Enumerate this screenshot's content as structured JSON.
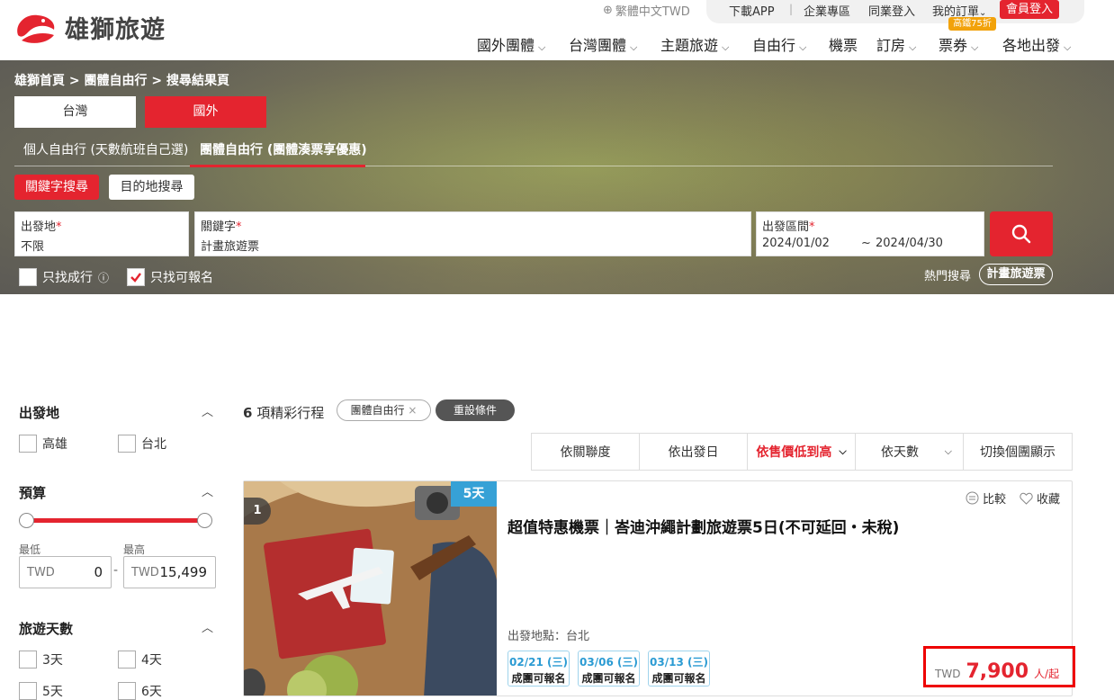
{
  "header": {
    "logo_text": "雄獅旅遊",
    "lang": "繁體中文TWD",
    "util": [
      "下載APP",
      "企業專區",
      "同業登入",
      "我的訂單"
    ],
    "login": "會員登入",
    "promo": "高鐵75折",
    "nav": [
      "國外團體",
      "台灣團體",
      "主題旅遊",
      "自由行",
      "機票",
      "訂房",
      "票券",
      "各地出發"
    ]
  },
  "search": {
    "breadcrumb": "雄獅首頁 > 團體自由行 > 搜尋結果頁",
    "region_tw": "台灣",
    "region_intl": "國外",
    "mode_personal": "個人自由行 (天數航班自己選)",
    "mode_group": "團體自由行 (團體湊票享優惠)",
    "keyword_search": "關鍵字搜尋",
    "dest_search": "目的地搜尋",
    "origin_label": "出發地",
    "origin_value": "不限",
    "keyword_label": "關鍵字",
    "keyword_value": "計畫旅遊票",
    "date_label": "出發區間",
    "date_start": "2024/01/02",
    "date_sep": "~",
    "date_end": "2024/04/30",
    "only_confirmed": "只找成行",
    "only_available": "只找可報名",
    "hot_label": "熱門搜尋",
    "hot_tag": "計畫旅遊票"
  },
  "sidebar": {
    "origin_title": "出發地",
    "origin_options": [
      "高雄",
      "台北"
    ],
    "budget_title": "預算",
    "min_label": "最低",
    "max_label": "最高",
    "currency": "TWD",
    "min_value": "0",
    "max_value": "15,499",
    "days_title": "旅遊天數",
    "day_options": [
      "3天",
      "4天",
      "5天",
      "6天"
    ]
  },
  "results": {
    "count": "6",
    "count_suffix": "項精彩行程",
    "filter_chip": "團體自由行",
    "reset": "重設條件",
    "sorts": [
      "依關聯度",
      "依出發日",
      "依售價低到高",
      "依天數",
      "切換個團顯示"
    ],
    "card": {
      "rank": "1",
      "days": "5天",
      "title": "超值特惠機票｜峇迪沖繩計劃旅遊票5日(不可延回・未稅)",
      "compare": "比較",
      "favorite": "收藏",
      "origin": "出發地點：台北",
      "dates": [
        {
          "date": "02/21 (三)",
          "status": "成團可報名"
        },
        {
          "date": "03/06 (三)",
          "status": "成團可報名"
        },
        {
          "date": "03/13 (三)",
          "status": "成團可報名"
        }
      ],
      "price_currency": "TWD",
      "price": "7,900",
      "price_unit": "人/起"
    }
  },
  "colors": {
    "accent": "#e4242f",
    "days_badge": "#36a1d6"
  }
}
